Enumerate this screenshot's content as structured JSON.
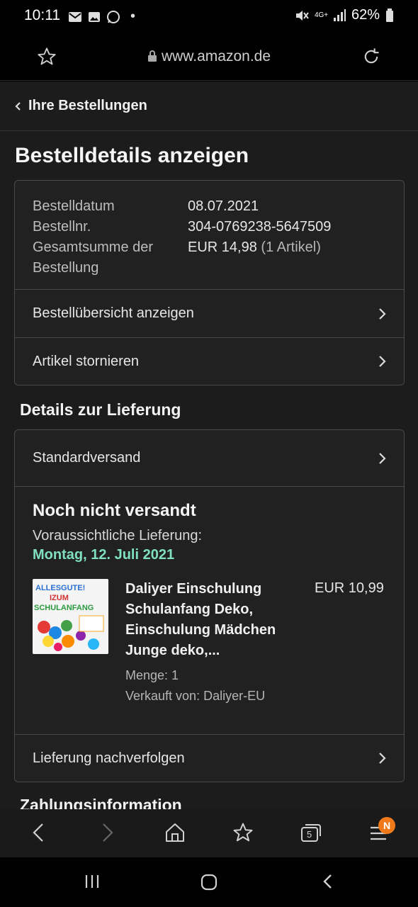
{
  "status_bar": {
    "time": "10:11",
    "battery": "62%",
    "network": "4G+"
  },
  "browser": {
    "url": "www.amazon.de",
    "tab_count": "5",
    "menu_badge": "N"
  },
  "breadcrumb": {
    "label": "Ihre Bestellungen"
  },
  "page_title": "Bestelldetails anzeigen",
  "order": {
    "date_label": "Bestelldatum",
    "date_value": "08.07.2021",
    "number_label": "Bestellnr.",
    "number_value": "304-0769238-5647509",
    "total_label_1": "Gesamtsumme der",
    "total_label_2": "Bestellung",
    "total_value": "EUR 14,98",
    "total_items": "(1 Artikel)"
  },
  "actions": {
    "summary": "Bestellübersicht anzeigen",
    "cancel": "Artikel stornieren"
  },
  "delivery": {
    "heading": "Details zur Lieferung",
    "method": "Standardversand",
    "status": "Noch nicht versandt",
    "expected_label": "Voraussichtliche Lieferung:",
    "expected_date": "Montag, 12. Juli 2021",
    "track": "Lieferung nachverfolgen",
    "date_color": "#7fdfc0"
  },
  "item": {
    "title": "Daliyer Einschulung Schulanfang Deko, Einschulung Mädchen Junge deko,...",
    "quantity": "Menge: 1",
    "seller": "Verkauft von: Daliyer-EU",
    "price": "EUR 10,99",
    "image_text": "ALLES GUTE! ZUM SCHULANFANG"
  },
  "payment": {
    "heading": "Zahlungsinformation"
  }
}
